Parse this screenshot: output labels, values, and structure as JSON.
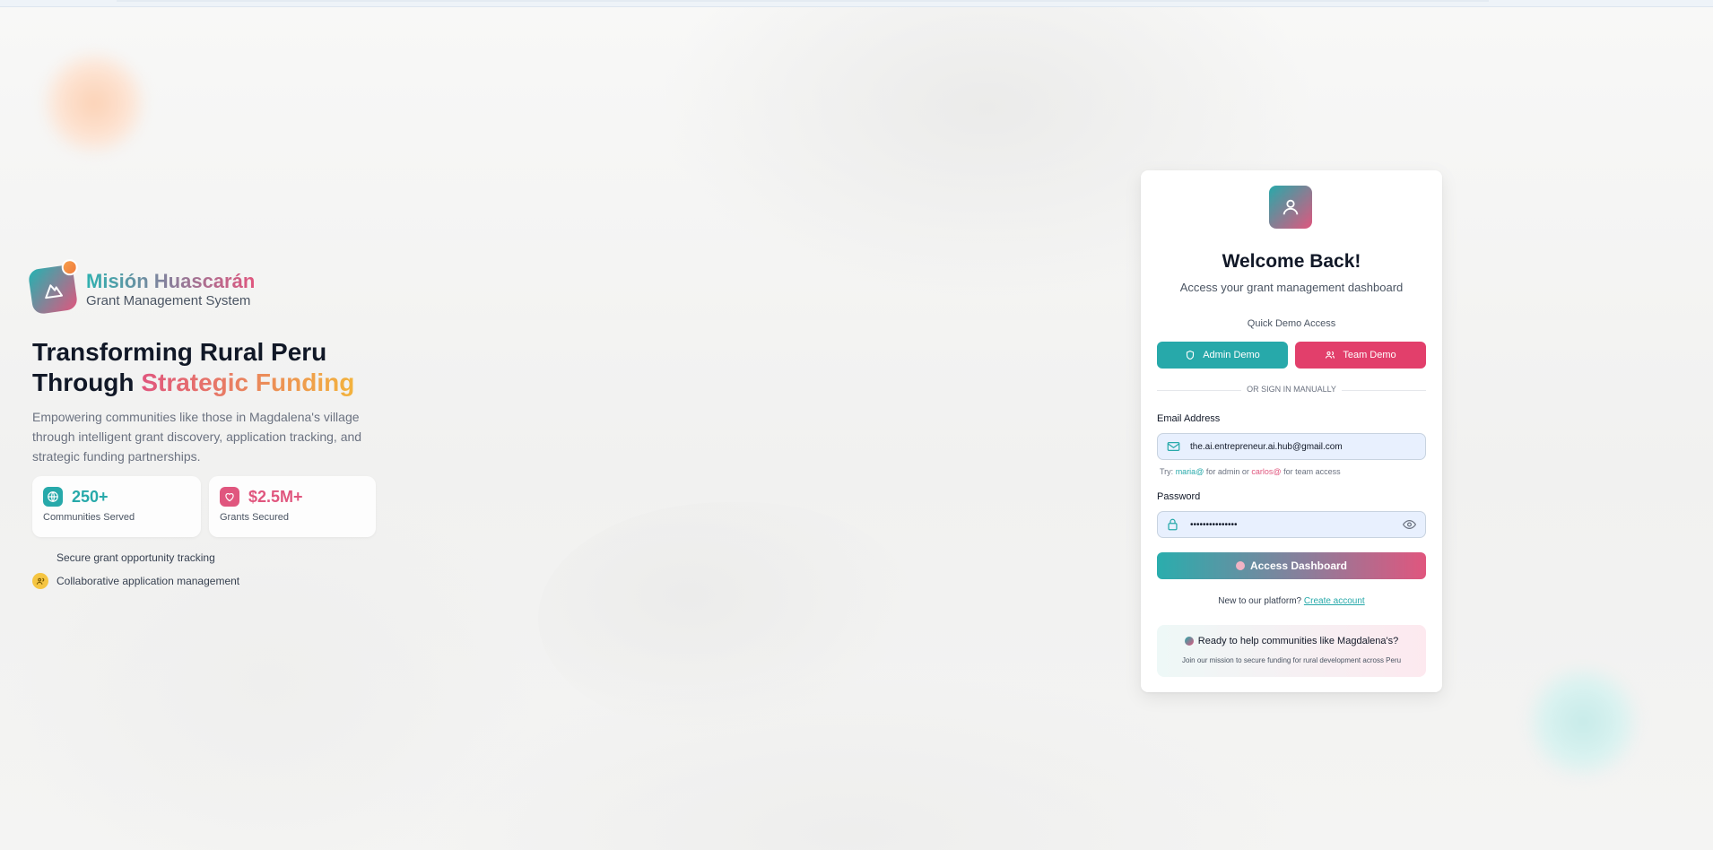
{
  "brand": {
    "name": "Misión Huascarán",
    "subtitle": "Grant Management System"
  },
  "hero": {
    "headline_line1": "Transforming Rural Peru",
    "headline_line2_prefix": "Through",
    "headline_line2_accent": "Strategic Funding",
    "description": "Empowering communities like those in Magdalena's village through intelligent grant discovery, application tracking, and strategic funding partnerships."
  },
  "stats": [
    {
      "value": "250+",
      "label": "Communities Served",
      "icon": "globe-icon",
      "color": "#27a9aa"
    },
    {
      "value": "$2.5M+",
      "label": "Grants Secured",
      "icon": "heart-icon",
      "color": "#e0567e"
    }
  ],
  "features": [
    {
      "text": "Secure grant opportunity tracking"
    },
    {
      "text": "Collaborative application management",
      "icon": "users-icon",
      "color": "#f5c542"
    }
  ],
  "login": {
    "title": "Welcome Back!",
    "subtitle": "Access your grant management dashboard",
    "quick_demo_label": "Quick Demo Access",
    "admin_demo_label": "Admin Demo",
    "team_demo_label": "Team Demo",
    "divider_text": "OR SIGN IN MANUALLY",
    "email_label": "Email Address",
    "email_value": "the.ai.entrepreneur.ai.hub@gmail.com",
    "hint_prefix": "Try:",
    "hint_admin_user": "maria@",
    "hint_admin_text": "for admin or",
    "hint_team_user": "carlos@",
    "hint_team_text": "for team access",
    "password_label": "Password",
    "password_value": "•••••••••••••••",
    "submit_label": "Access Dashboard",
    "new_platform_text": "New to our platform?",
    "create_account_label": "Create account",
    "promo_title": "Ready to help communities like Magdalena's?",
    "promo_subtitle": "Join our mission to secure funding for rural development across Peru"
  },
  "colors": {
    "teal": "#27a9aa",
    "pink": "#e0567e",
    "input_bg": "#e8f0fe"
  }
}
